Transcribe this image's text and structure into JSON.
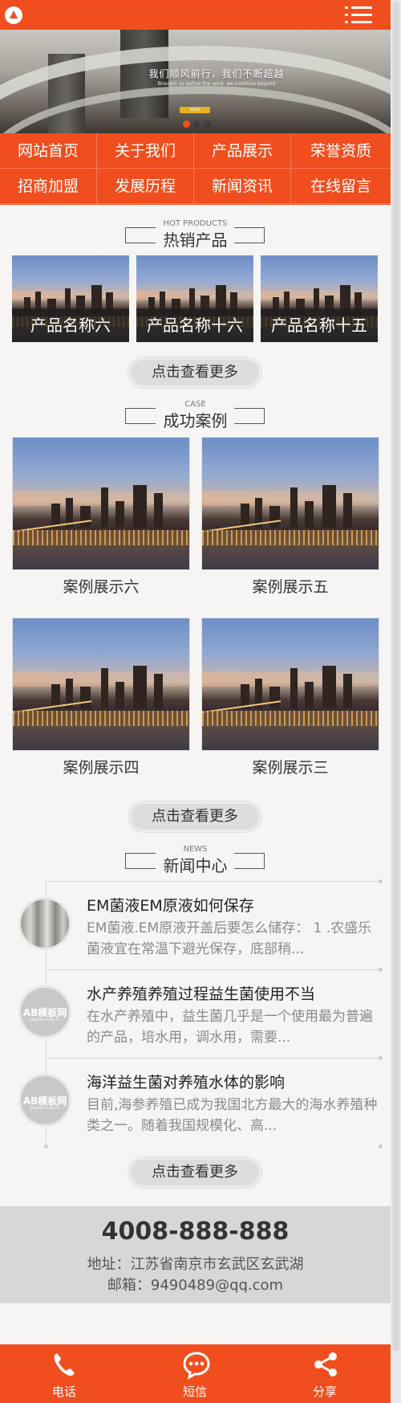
{
  "header": {
    "logo": "logo-icon",
    "menu": "menu-icon"
  },
  "banner": {
    "headline": "我们顺风前行，我们不断超越",
    "sub": "Brought us before the wind, we continue beyond",
    "button": "MORE",
    "slides": 3,
    "active_slide": 1
  },
  "nav": {
    "items": [
      "网站首页",
      "关于我们",
      "产品展示",
      "荣誉资质",
      "招商加盟",
      "发展历程",
      "新闻资讯",
      "在线留言"
    ]
  },
  "products": {
    "en": "HOT PRODUCTS",
    "title": "热销产品",
    "items": [
      "产品名称六",
      "产品名称十六",
      "产品名称十五"
    ],
    "more": "点击查看更多"
  },
  "cases": {
    "en": "CASE",
    "title": "成功案例",
    "items": [
      "案例展示六",
      "案例展示五",
      "案例展示四",
      "案例展示三"
    ],
    "more": "点击查看更多"
  },
  "news": {
    "en": "NEWS",
    "title": "新闻中心",
    "items": [
      {
        "title": "EM菌液EM原液如何保存",
        "desc": "EM菌液.EM原液开盖后要怎么储存： 1 .农盛乐菌液宜在常温下避光保存，底部稍...",
        "thumb": "photo"
      },
      {
        "title": "水产养殖养殖过程益生菌使用不当",
        "desc": "在水产养殖中，益生菌几乎是一个使用最为普遍的产品，培水用，调水用，需要...",
        "thumb": "logo"
      },
      {
        "title": "海洋益生菌对养殖水体的影响",
        "desc": "目前,海参养殖已成为我国北方最大的海水养殖种类之一。随着我国规模化、高...",
        "thumb": "logo"
      }
    ],
    "thumb_logo": "AB模板网",
    "thumb_logo_sub": "Www.AdminBuy.Cn",
    "more": "点击查看更多"
  },
  "contact": {
    "phone": "4008-888-888",
    "address": "地址：江苏省南京市玄武区玄武湖",
    "email": "邮箱：9490489@qq.com"
  },
  "bottom_bar": {
    "items": [
      {
        "label": "电话",
        "icon": "phone-icon"
      },
      {
        "label": "短信",
        "icon": "message-icon"
      },
      {
        "label": "分享",
        "icon": "share-icon"
      }
    ]
  },
  "colors": {
    "accent": "#f04e1e",
    "bg": "#f6f5f4",
    "contact_bg": "#d8d7d6"
  }
}
